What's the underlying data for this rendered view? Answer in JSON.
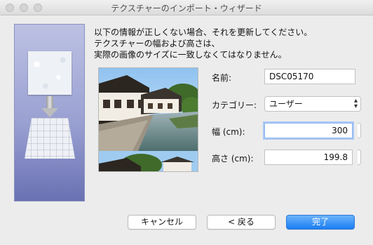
{
  "window": {
    "title": "テクスチャーのインポート・ウィザード"
  },
  "instructions": {
    "line1": "以下の情報が正しくない場合、それを更新してください。",
    "line2": "テクスチャーの幅および高さは、",
    "line3": "実際の画像のサイズに一致しなくてはなりません。"
  },
  "form": {
    "name_label": "名前:",
    "name_value": "DSC05170",
    "category_label": "カテゴリー:",
    "category_value": "ユーザー",
    "width_label": "幅 (cm):",
    "width_value": "300",
    "height_label": "高さ (cm):",
    "height_value": "199.8"
  },
  "buttons": {
    "cancel": "キャンセル",
    "back": "< 戻る",
    "finish": "完了"
  },
  "colors": {
    "accent": "#1b7ef3",
    "side_panel_top": "#bcc1e3",
    "side_panel_bottom": "#6a71b3"
  }
}
